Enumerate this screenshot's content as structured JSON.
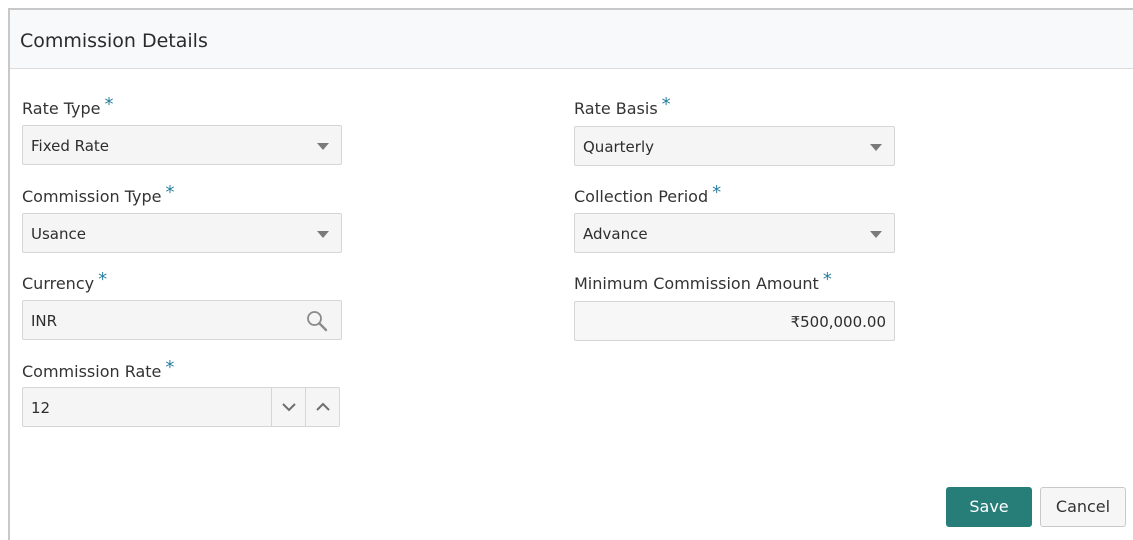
{
  "panel": {
    "title": "Commission Details"
  },
  "fields": {
    "rate_type": {
      "label": "Rate Type",
      "required": "*",
      "value": "Fixed Rate"
    },
    "rate_basis": {
      "label": "Rate Basis",
      "required": "*",
      "value": "Quarterly"
    },
    "commission_type": {
      "label": "Commission Type",
      "required": "*",
      "value": "Usance"
    },
    "collection_period": {
      "label": "Collection Period",
      "required": "*",
      "value": "Advance"
    },
    "currency": {
      "label": "Currency",
      "required": "*",
      "value": "INR",
      "icon": "search-icon"
    },
    "minimum_commission_amount": {
      "label": "Minimum Commission Amount",
      "required": "*",
      "value": "₹500,000.00"
    },
    "commission_rate": {
      "label": "Commission Rate",
      "required": "*",
      "value": "12"
    }
  },
  "actions": {
    "save_label": "Save",
    "cancel_label": "Cancel"
  },
  "colors": {
    "accent": "#277e79",
    "required_marker": "#2a7f9e"
  }
}
